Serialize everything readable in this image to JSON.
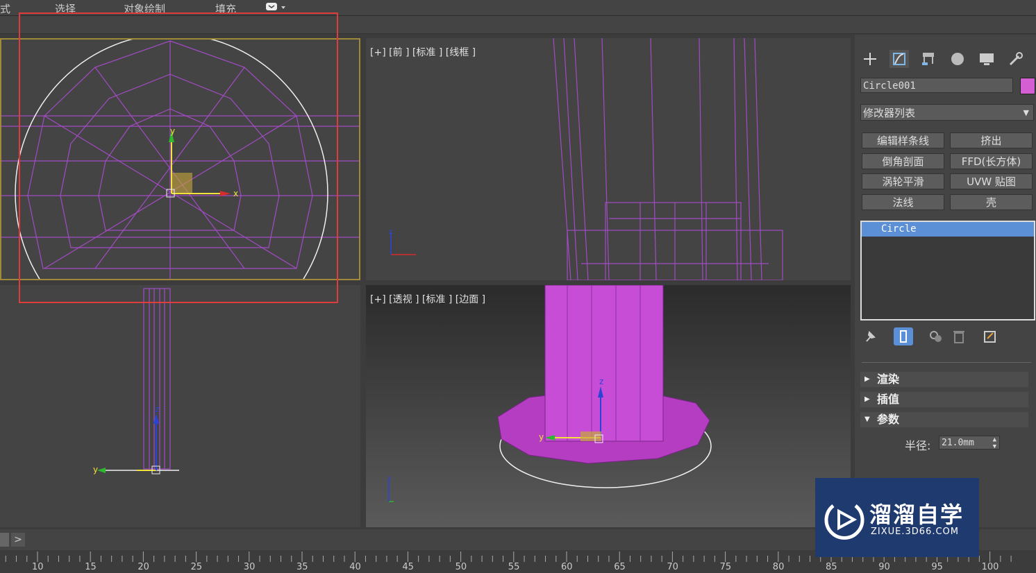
{
  "menubar": {
    "items": [
      "式",
      "选择",
      "对象绘制",
      "填充"
    ]
  },
  "viewports": {
    "front": {
      "label": "[+] [前 ] [标准 ] [线框 ]"
    },
    "perspective": {
      "label": "[+] [透视 ] [标准 ] [边面 ]"
    }
  },
  "command_panel": {
    "object_name": "Circle001",
    "object_color": "#d35fd3",
    "modifier_list": "修改器列表",
    "modifiers": [
      "编辑样条线",
      "挤出",
      "倒角剖面",
      "FFD(长方体)",
      "涡轮平滑",
      "UVW 贴图",
      "法线",
      "壳"
    ],
    "stack_item": "Circle",
    "rollouts": {
      "render": "渲染",
      "interp": "插值",
      "params": "参数"
    },
    "radius_label": "半径:",
    "radius_value": "21.0mm"
  },
  "timeline": {
    "ticks": [
      "10",
      "15",
      "20",
      "25",
      "30",
      "35",
      "40",
      "45",
      "50",
      "55",
      "60",
      "65",
      "70",
      "75",
      "80",
      "85",
      "90",
      "95",
      "100"
    ]
  },
  "watermark": {
    "title": "溜溜自学",
    "url": "ZIXUE.3D66.COM"
  },
  "accent": {
    "selection_box": "#e03c3c",
    "object": "#c74cd6",
    "active_viewport_border": "#a08a3a",
    "stack_highlight": "#5b8fd6"
  }
}
